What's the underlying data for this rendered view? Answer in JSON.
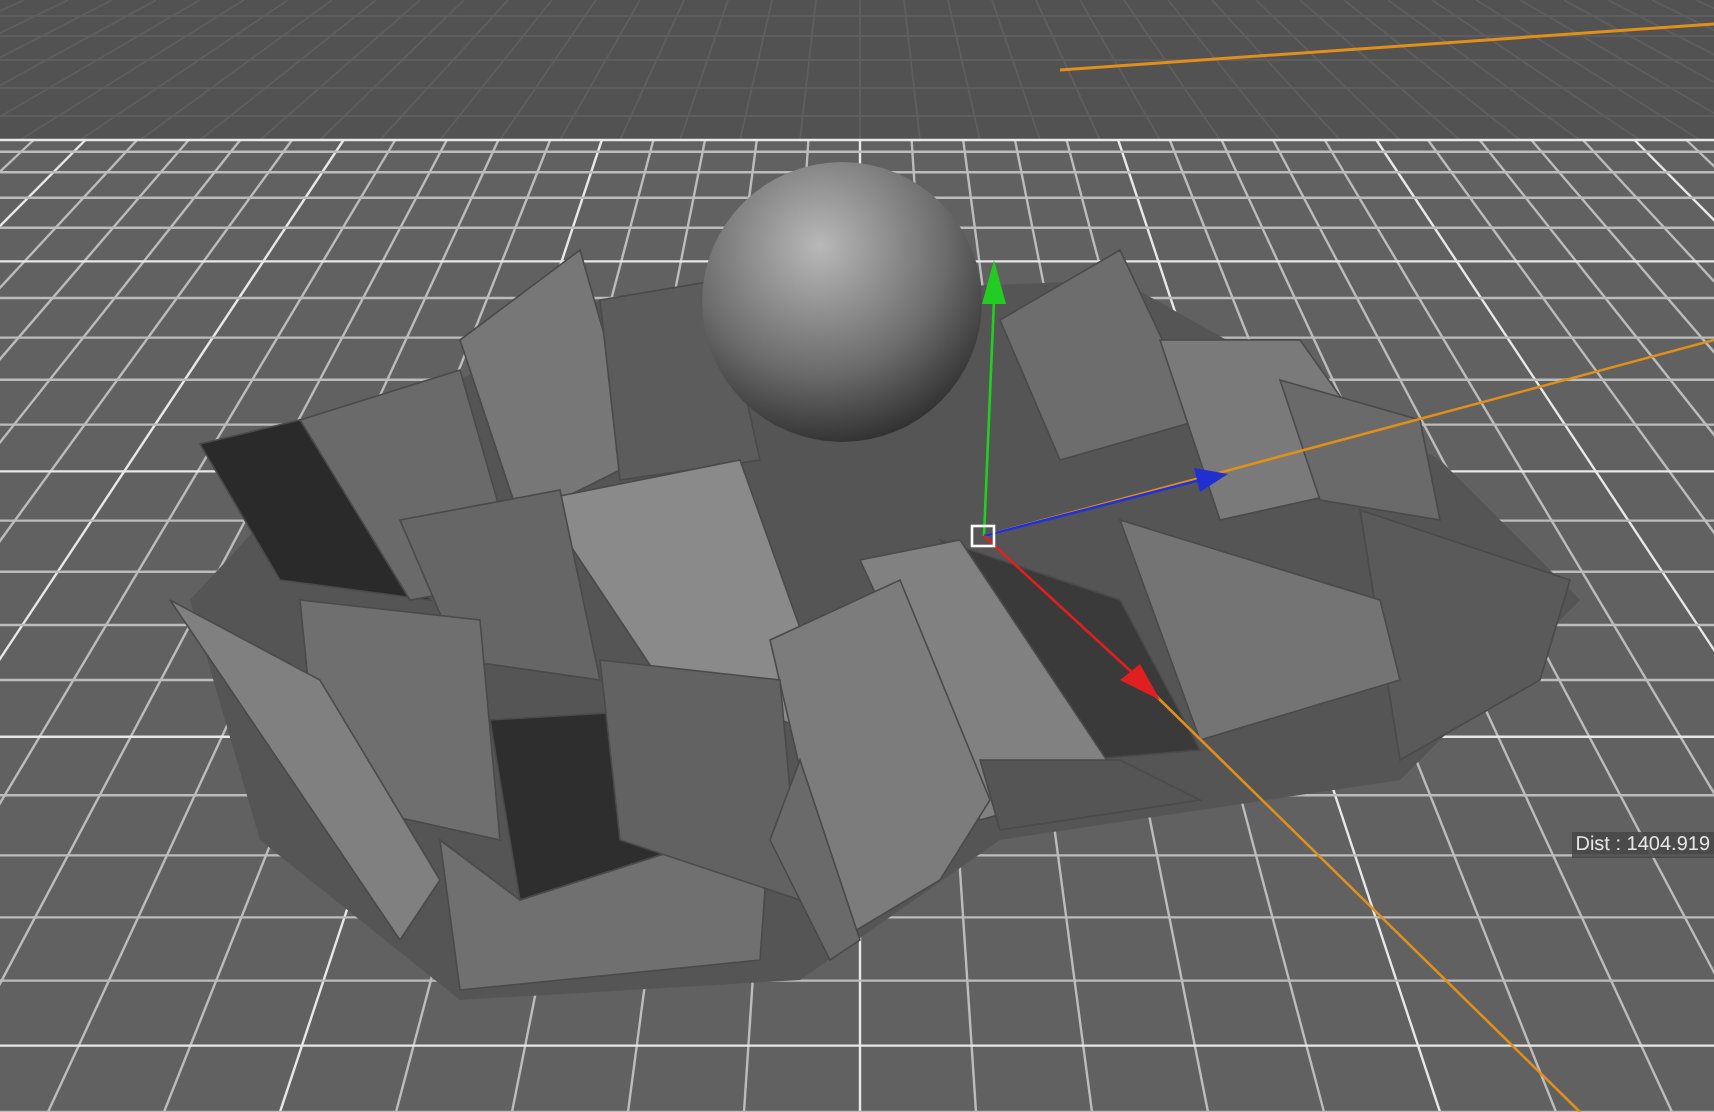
{
  "viewport": {
    "distance_readout": "Dist : 1404.919"
  }
}
